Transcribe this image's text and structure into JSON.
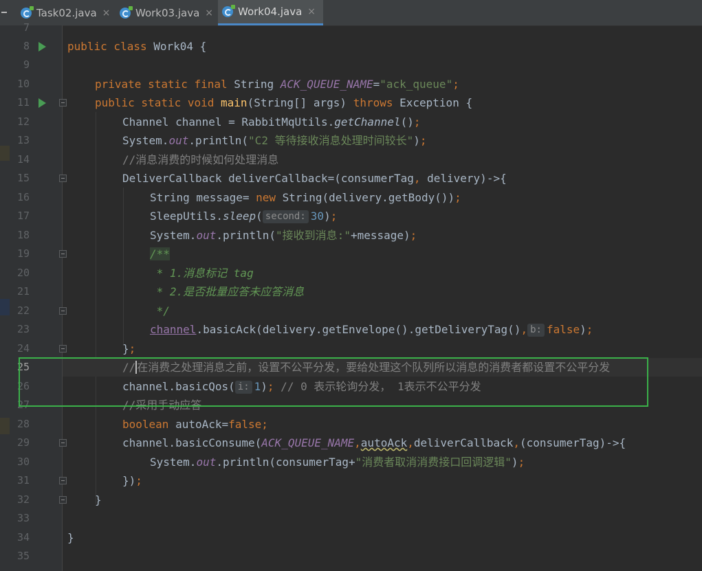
{
  "tabs": [
    {
      "label": "Task02.java",
      "close": "×",
      "active": false
    },
    {
      "label": "Work03.java",
      "close": "×",
      "active": false
    },
    {
      "label": "Work04.java",
      "close": "×",
      "active": true
    }
  ],
  "code": {
    "l7": "7",
    "l8": "8",
    "l9": "9",
    "l10": "10",
    "l11": "11",
    "l12": "12",
    "l13": "13",
    "l14": "14",
    "l15": "15",
    "l16": "16",
    "l17": "17",
    "l18": "18",
    "l19": "19",
    "l20": "20",
    "l21": "21",
    "l22": "22",
    "l23": "23",
    "l24": "24",
    "l25": "25",
    "l26": "26",
    "l27": "27",
    "l28": "28",
    "l29": "29",
    "l30": "30",
    "l31": "31",
    "l32": "32",
    "l33": "33",
    "l34": "34",
    "l35": "35",
    "t8": {
      "kw": "public class ",
      "name": "Work04 {"
    },
    "t10": {
      "kw": "private static final ",
      "type": "String ",
      "const": "ACK_QUEUE_NAME",
      "eq": "=",
      "str": "\"ack_queue\"",
      "semi": ";"
    },
    "t11": {
      "kw": "public static void ",
      "fn": "main",
      "params": "(String[] args) ",
      "kw2": "throws ",
      "rest": "Exception {"
    },
    "t12": {
      "a": "Channel channel = RabbitMqUtils.",
      "b": "getChannel",
      "c": "()",
      "semi": ";"
    },
    "t13": {
      "a": "System.",
      "b": "out",
      "c": ".println(",
      "str": "\"C2 等待接收消息处理时间较长\"",
      "d": ")",
      "semi": ";"
    },
    "t14": {
      "cmt": "//消息消费的时候如何处理消息"
    },
    "t15": {
      "a": "DeliverCallback deliverCallback=(consumerTag",
      "comma": ",",
      "b": " delivery)->{"
    },
    "t16": {
      "a": "String message= ",
      "kw": "new ",
      "b": "String(delivery.getBody())",
      "semi": ";"
    },
    "t17": {
      "a": "SleepUtils.",
      "b": "sleep",
      "c": "(",
      "hint": "second:",
      "num": "30",
      "d": ")",
      "semi": ";"
    },
    "t18": {
      "a": "System.",
      "b": "out",
      "c": ".println(",
      "str": "\"接收到消息:\"",
      "d": "+message)",
      "semi": ";"
    },
    "t19": {
      "doc": "/**"
    },
    "t20": {
      "doc": " * 1.消息标记 tag"
    },
    "t21": {
      "doc": " * 2.是否批量应答未应答消息"
    },
    "t22": {
      "doc": " */"
    },
    "t23": {
      "field": "channel",
      "a": ".basicAck(delivery.getEnvelope().getDeliveryTag()",
      "comma": ",",
      "hint": "b:",
      "kw": "false",
      "d": ")",
      "semi": ";"
    },
    "t24": {
      "a": "}",
      "semi": ";"
    },
    "t25": {
      "c1": "//",
      "c2": "在消费之处理消息之前，设置不公平分发，要给处理这个队列所以消息的消费者都设置不公平分发"
    },
    "t26": {
      "a": "channel.basicQos(",
      "hint": "i:",
      "num": "1",
      "d": ")",
      "semi": ";",
      "cmt": " // 0 表示轮询分发， 1表示不公平分发"
    },
    "t27": {
      "cmt": "//采用手动应答"
    },
    "t28": {
      "kw": "boolean ",
      "a": "autoAck=",
      "kw2": "false",
      "semi": ";"
    },
    "t29": {
      "a": "channel.basicConsume(",
      "const": "ACK_QUEUE_NAME",
      "comma1": ",",
      "b": "autoAck",
      "comma2": ",",
      "c": "deliverCallback",
      "comma3": ",",
      "d": "(consumerTag)->{"
    },
    "t30": {
      "a": "System.",
      "b": "out",
      "c": ".println(consumerTag+",
      "str": "\"消费者取消消费接口回调逻辑\"",
      "d": ")",
      "semi": ";"
    },
    "t31": {
      "a": "})",
      "semi": ";"
    },
    "t32": {
      "a": "}"
    },
    "t34": {
      "a": "}"
    }
  },
  "colors": {
    "background": "#2b2b2b",
    "keyword": "#cc7832",
    "string": "#6a8759",
    "constant": "#9876aa",
    "method": "#ffc66d",
    "comment": "#808080",
    "doc_comment": "#629755",
    "number": "#6897bb",
    "highlight_box": "#3bb14a"
  }
}
